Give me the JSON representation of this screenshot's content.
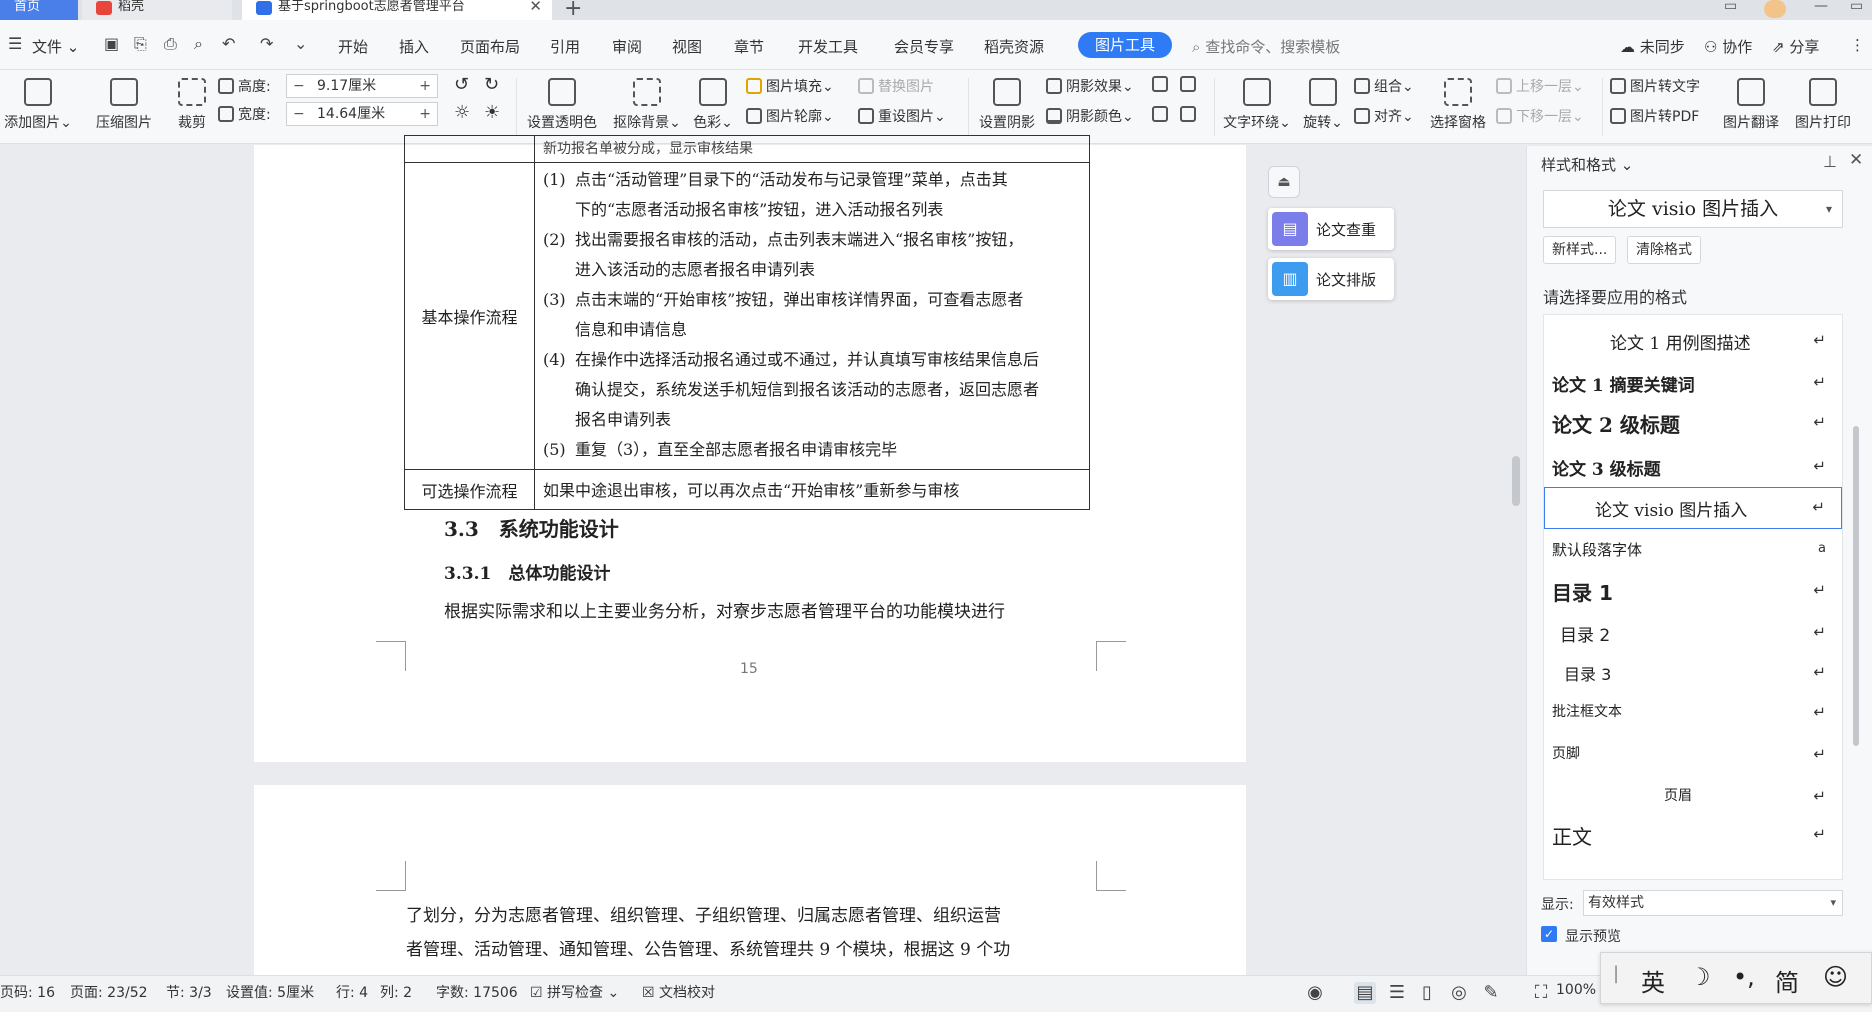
{
  "tabs": [
    {
      "label": "首页"
    },
    {
      "label": "稻壳"
    },
    {
      "label": "基于springboot志愿者管理平台"
    }
  ],
  "menu": {
    "file_label": "文件",
    "items": [
      "开始",
      "插入",
      "页面布局",
      "引用",
      "审阅",
      "视图",
      "章节",
      "开发工具",
      "会员专享",
      "稻壳资源"
    ],
    "active_tab": "图片工具",
    "search_placeholder": "查找命令、搜索模板",
    "right": [
      "未同步",
      "协作",
      "分享"
    ]
  },
  "ribbon": {
    "add_picture": "添加图片",
    "compress": "压缩图片",
    "crop": "裁剪",
    "height_label": "高度:",
    "height_value": "9.17厘米",
    "width_label": "宽度:",
    "width_value": "14.64厘米",
    "transparent": "设置透明色",
    "remove_bg": "抠除背景",
    "color": "色彩",
    "fill": "图片填充",
    "replace": "替换图片",
    "outline": "图片轮廓",
    "reset": "重设图片",
    "set_shadow": "设置阴影",
    "shadow_effect": "阴影效果",
    "shadow_color": "阴影颜色",
    "wrap": "文字环绕",
    "rotate": "旋转",
    "group": "组合",
    "align": "对齐",
    "select_pane": "选择窗格",
    "bring_forward": "上移一层",
    "send_backward": "下移一层",
    "to_text": "图片转文字",
    "to_pdf": "图片转PDF",
    "translate": "图片翻译",
    "print": "图片打印"
  },
  "document": {
    "table_top_partial": "新功报名单被分成，显示审核结果",
    "row_label_basic": "基本操作流程",
    "steps": [
      {
        "num": "(1)",
        "lines": [
          "点击“活动管理”目录下的“活动发布与记录管理”菜单，点击其",
          "下的“志愿者活动报名审核”按钮，进入活动报名列表"
        ]
      },
      {
        "num": "(2)",
        "lines": [
          "找出需要报名审核的活动，点击列表末端进入“报名审核”按钮，",
          "进入该活动的志愿者报名申请列表"
        ]
      },
      {
        "num": "(3)",
        "lines": [
          "点击末端的“开始审核”按钮，弹出审核详情界面，可查看志愿者",
          "信息和申请信息"
        ]
      },
      {
        "num": "(4)",
        "lines": [
          "在操作中选择活动报名通过或不通过，并认真填写审核结果信息后",
          "确认提交，系统发送手机短信到报名该活动的志愿者，返回志愿者",
          "报名申请列表"
        ]
      },
      {
        "num": "(5)",
        "lines": [
          "重复（3），直至全部志愿者报名申请审核完毕"
        ]
      }
    ],
    "row_label_optional": "可选操作流程",
    "optional_text": "如果中途退出审核，可以再次点击“开始审核”重新参与审核",
    "heading_3_3": "3.3　系统功能设计",
    "heading_3_3_1": "3.3.1　总体功能设计",
    "para1": "根据实际需求和以上主要业务分析，对寮步志愿者管理平台的功能模块进行",
    "page_number": "15",
    "para2_line1": "了划分，分为志愿者管理、组织管理、子组织管理、归属志愿者管理、组织运营",
    "para2_line2": "者管理、活动管理、通知管理、公告管理、系统管理共 9 个模块，根据这 9 个功"
  },
  "float_buttons": [
    {
      "label": "论文查重",
      "color": "#7b7de8"
    },
    {
      "label": "论文排版",
      "color": "#3d9bf0"
    }
  ],
  "panel": {
    "title": "样式和格式",
    "current_style": "论文 visio 图片插入",
    "new_style": "新样式...",
    "clear_format": "清除格式",
    "prompt": "请选择要应用的格式",
    "styles": [
      {
        "label": "论文 1 用例图描述"
      },
      {
        "label": "论文 1 摘要关键词"
      },
      {
        "label": "论文 2 级标题"
      },
      {
        "label": "论文 3 级标题"
      },
      {
        "label": "论文 visio 图片插入"
      },
      {
        "label": "默认段落字体"
      },
      {
        "label": "目录 1"
      },
      {
        "label": "目录 2"
      },
      {
        "label": "目录 3"
      },
      {
        "label": "批注框文本"
      },
      {
        "label": "页脚"
      },
      {
        "label": "页眉"
      },
      {
        "label": "正文"
      }
    ],
    "show_label": "显示:",
    "show_value": "有效样式",
    "preview_label": "显示预览"
  },
  "status": {
    "page_code": "页码: 16",
    "page": "页面: 23/52",
    "section": "节: 3/3",
    "setting": "设置值: 5厘米",
    "row": "行: 4",
    "col": "列: 2",
    "words": "字数: 17506",
    "spell": "拼写检查",
    "proof": "文档校对",
    "zoom": "100%"
  },
  "ime": {
    "lang": "英",
    "simp": "简"
  }
}
